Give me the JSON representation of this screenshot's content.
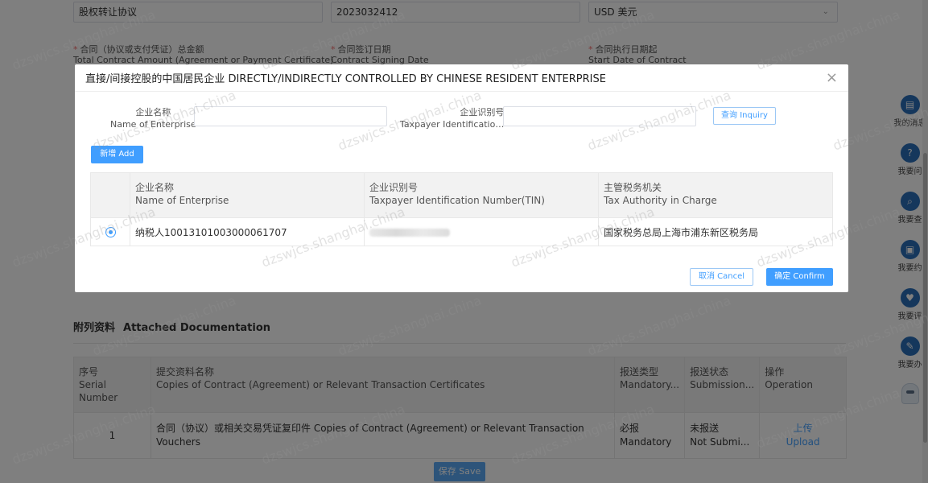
{
  "background": {
    "top_fields": {
      "field1_value": "股权转让协议",
      "field2_value": "2023032412",
      "currency_value": "USD 美元"
    },
    "labels": {
      "total_amount_cn": "合同（协议或支付凭证）总金额",
      "total_amount_en": "Total Contract Amount (Agreement or Payment Certificate)",
      "signing_date_cn": "合同签订日期",
      "signing_date_en": "Contract Signing Date",
      "start_date_cn": "合同执行日期起",
      "start_date_en": "Start Date of Contract"
    },
    "attached": {
      "title_cn": "附列资料",
      "title_en": "Attached Documentation",
      "headers": [
        {
          "cn": "序号",
          "en": "Serial Number"
        },
        {
          "cn": "提交资料名称",
          "en": "Copies of Contract (Agreement) or Relevant Transaction Certificates"
        },
        {
          "cn": "报送类型",
          "en": "Mandatory..."
        },
        {
          "cn": "报送状态",
          "en": "Submission..."
        },
        {
          "cn": "操作",
          "en": "Operation"
        }
      ],
      "row": {
        "serial": "1",
        "name": "合同（协议）或相关交易凭证复印件 Copies of Contract (Agreement) or Relevant Transaction Vouchers",
        "type_cn": "必报",
        "type_en": "Mandatory",
        "status_cn": "未报送",
        "status_en": "Not Submi...",
        "upload_cn": "上传",
        "upload_en": "Upload"
      }
    },
    "save_label": "保存 Save"
  },
  "rail": [
    {
      "icon": "message-icon",
      "label": "我的消息"
    },
    {
      "icon": "question-icon",
      "label": "我要问"
    },
    {
      "icon": "search-icon",
      "label": "我要查"
    },
    {
      "icon": "calendar-icon",
      "label": "我要约"
    },
    {
      "icon": "rate-icon",
      "label": "我要评"
    },
    {
      "icon": "edit-icon",
      "label": "我要办"
    }
  ],
  "dialog": {
    "title": "直接/间接控股的中国居民企业   DIRECTLY/INDIRECTLY CONTROLLED BY CHINESE RESIDENT ENTERPRISE",
    "close": "×",
    "query": {
      "name_label_cn": "企业名称",
      "name_label_en": "Name of Enterprise",
      "tin_label_cn": "企业识别号",
      "tin_label_en": "Taxpayer Identificatio…",
      "inquiry_label": "查询   Inquiry"
    },
    "add_label": "新增   Add",
    "table": {
      "headers": [
        {
          "cn": "企业名称",
          "en": "Name of Enterprise"
        },
        {
          "cn": "企业识别号",
          "en": "Taxpayer Identification Number(TIN)"
        },
        {
          "cn": "主管税务机关",
          "en": "Tax Authority in Charge"
        }
      ],
      "rows": [
        {
          "name": "纳税人10013101003000061707",
          "authority": "国家税务总局上海市浦东新区税务局"
        }
      ]
    },
    "cancel_label": "取消   Cancel",
    "confirm_label": "确定   Confirm"
  },
  "watermark": "dzswjcs.shanghai.china"
}
